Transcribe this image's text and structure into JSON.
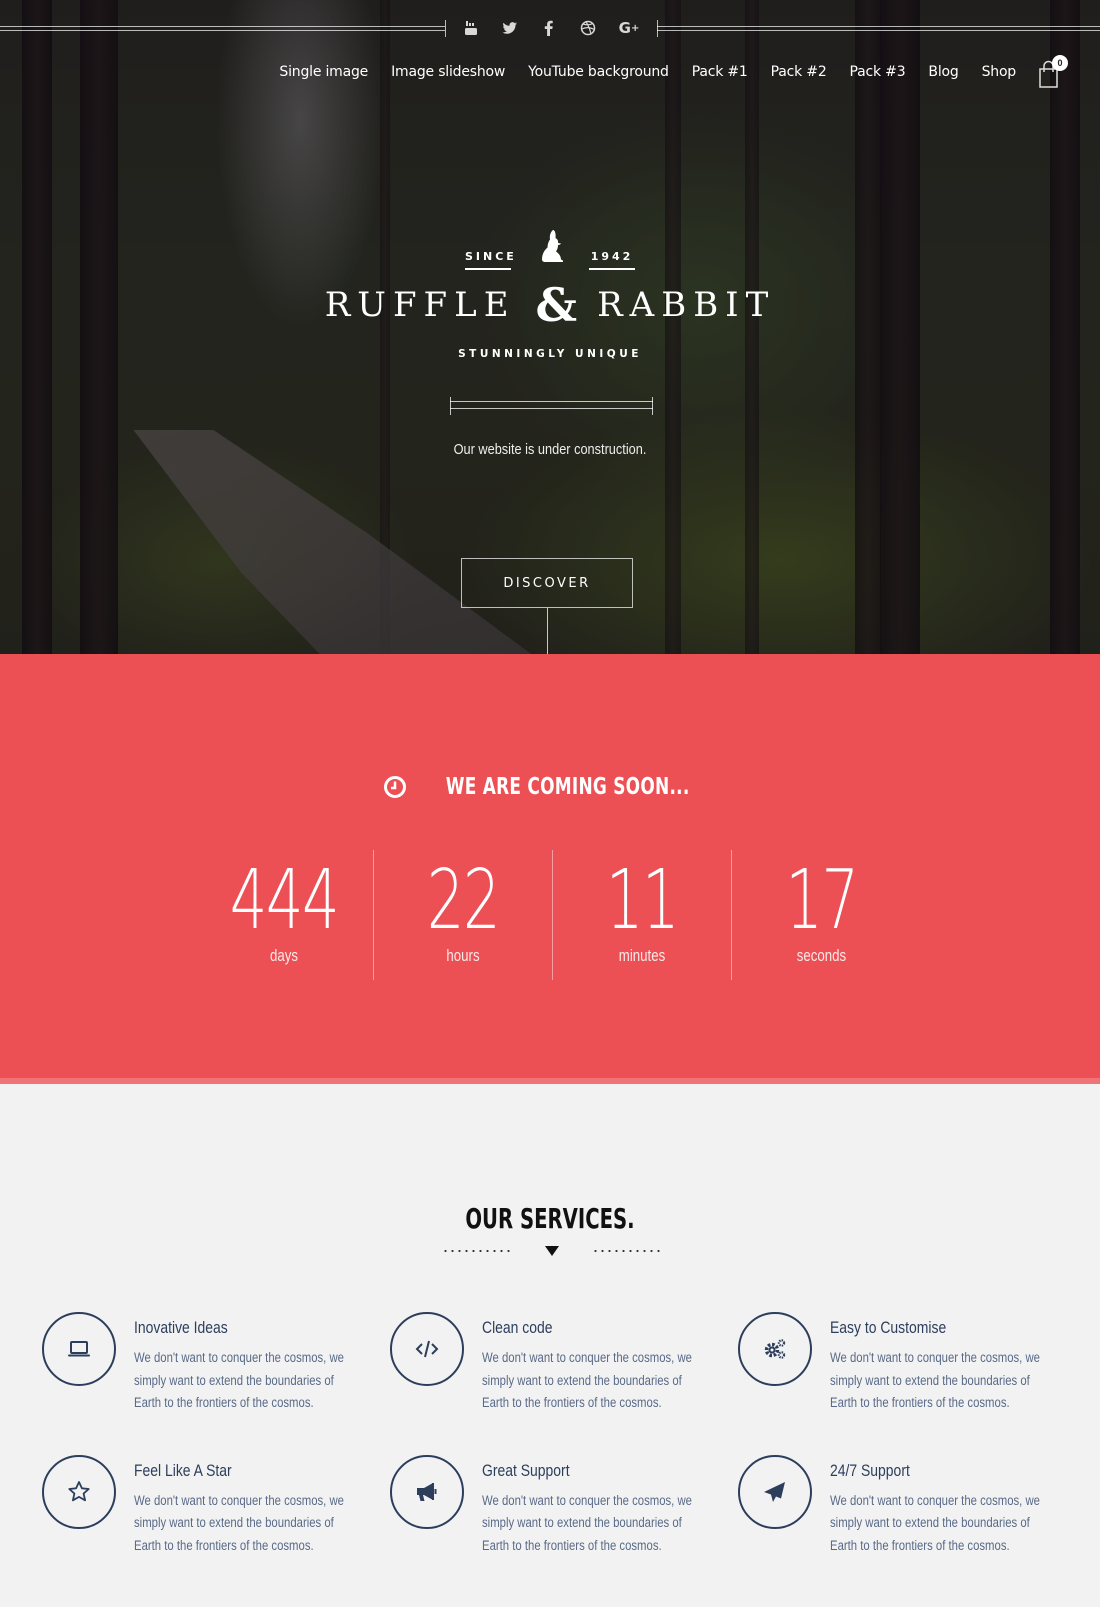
{
  "social": {
    "items": [
      {
        "name": "youtube",
        "label": "You Tube"
      },
      {
        "name": "twitter",
        "label": "Twitter"
      },
      {
        "name": "facebook",
        "label": "f"
      },
      {
        "name": "dribbble",
        "label": "Dribbble"
      },
      {
        "name": "google-plus",
        "label": "G+"
      }
    ]
  },
  "nav": {
    "items": [
      {
        "label": "Single image"
      },
      {
        "label": "Image slideshow"
      },
      {
        "label": "YouTube background"
      },
      {
        "label": "Pack #1"
      },
      {
        "label": "Pack #2"
      },
      {
        "label": "Pack #3"
      },
      {
        "label": "Blog"
      },
      {
        "label": "Shop"
      }
    ],
    "cart_count": "0"
  },
  "hero": {
    "since_label": "SINCE",
    "since_year": "1942",
    "brand_left": "RUFFLE",
    "brand_amp": "&",
    "brand_right": "RABBIT",
    "tagline": "STUNNINGLY UNIQUE",
    "subtitle": "Our website is under construction.",
    "cta_label": "DISCOVER"
  },
  "countdown": {
    "title": "WE ARE COMING SOON...",
    "accent_color": "#ec5055",
    "units": [
      {
        "value": "444",
        "label": "days"
      },
      {
        "value": "22",
        "label": "hours"
      },
      {
        "value": "11",
        "label": "minutes"
      },
      {
        "value": "17",
        "label": "seconds"
      }
    ]
  },
  "services": {
    "title": "OUR SERVICES.",
    "icon_color": "#2c3e5c",
    "items": [
      {
        "icon": "laptop",
        "title": "Inovative Ideas",
        "desc": "We don't want to conquer the cosmos, we simply want to extend the boundaries of Earth to the frontiers of the cosmos."
      },
      {
        "icon": "code",
        "title": "Clean code",
        "desc": "We don't want to conquer the cosmos, we simply want to extend the boundaries of Earth to the frontiers of the cosmos."
      },
      {
        "icon": "gears",
        "title": "Easy to Customise",
        "desc": "We don't want to conquer the cosmos, we simply want to extend the boundaries of Earth to the frontiers of the cosmos."
      },
      {
        "icon": "star",
        "title": "Feel Like A Star",
        "desc": "We don't want to conquer the cosmos, we simply want to extend the boundaries of Earth to the frontiers of the cosmos."
      },
      {
        "icon": "megaphone",
        "title": "Great Support",
        "desc": "We don't want to conquer the cosmos, we simply want to extend the boundaries of Earth to the frontiers of the cosmos."
      },
      {
        "icon": "paper-plane",
        "title": "24/7 Support",
        "desc": "We don't want to conquer the cosmos, we simply want to extend the boundaries of Earth to the frontiers of the cosmos."
      }
    ]
  }
}
